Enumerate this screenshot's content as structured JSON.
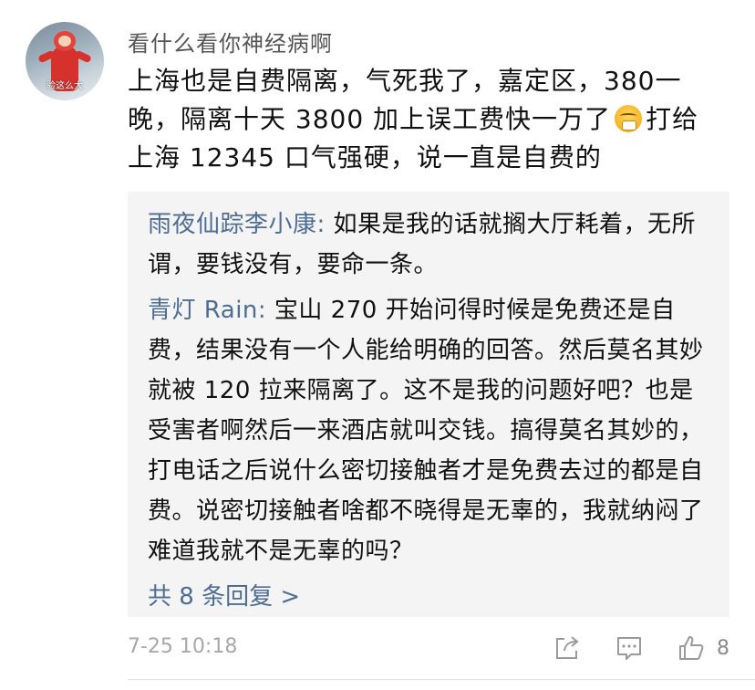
{
  "comment": {
    "avatar_watermark": "验这么大",
    "username": "看什么看你神经病啊",
    "text_before_emoji": "上海也是自费隔离，气死我了，嘉定区，380一晚，隔离十天 3800 加上误工费快一万了",
    "emoji": "tired-face-icon",
    "text_after_emoji": "打给上海 12345 口气强硬，说一直是自费的",
    "time": "7-25 10:18",
    "like_count": "8"
  },
  "replies": [
    {
      "author": "雨夜仙踪李小康:",
      "text": " 如果是我的话就搁大厅耗着，无所谓，要钱没有，要命一条。"
    },
    {
      "author": "青灯 Rain:",
      "text": " 宝山 270 开始问得时候是免费还是自费，结果没有一个人能给明确的回答。然后莫名其妙就被 120 拉来隔离了。这不是我的问题好吧？也是受害者啊然后一来酒店就叫交钱。搞得莫名其妙的，打电话之后说什么密切接触者才是免费去过的都是自费。说密切接触者啥都不晓得是无辜的，我就纳闷了难道我就不是无辜的吗？"
    }
  ],
  "more_replies_label": "共 8 条回复 >",
  "colors": {
    "author_link": "#4e6d94",
    "reply_bg": "#f4f4f4",
    "muted": "#a8a8a8"
  }
}
